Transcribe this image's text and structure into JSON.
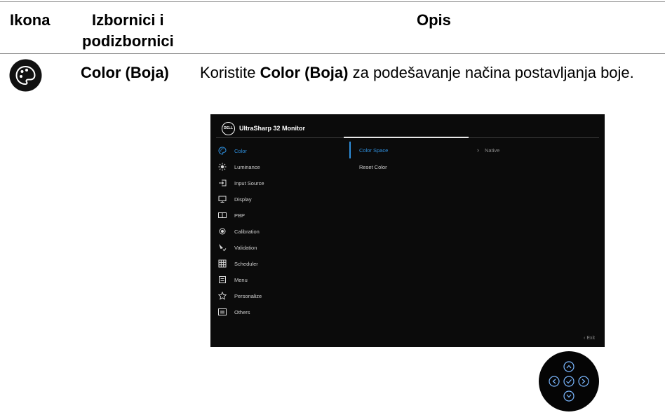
{
  "table": {
    "headers": {
      "icon": "Ikona",
      "menus_line1": "Izbornici i",
      "menus_line2": "podizbornici",
      "description": "Opis"
    },
    "row": {
      "icon_name": "palette-icon",
      "menu_title": "Color (Boja)",
      "desc_prefix": "Koristite ",
      "desc_bold": "Color (Boja)",
      "desc_suffix": " za podešavanje načina postavljanja boje."
    }
  },
  "osd": {
    "model": "UltraSharp 32 Monitor",
    "logo_text": "DELL",
    "menu_items": [
      {
        "label": "Color",
        "icon": "palette-icon"
      },
      {
        "label": "Luminance",
        "icon": "sun-icon"
      },
      {
        "label": "Input Source",
        "icon": "input-icon"
      },
      {
        "label": "Display",
        "icon": "monitor-icon"
      },
      {
        "label": "PBP",
        "icon": "split-screen-icon"
      },
      {
        "label": "Calibration",
        "icon": "target-icon"
      },
      {
        "label": "Validation",
        "icon": "validation-icon"
      },
      {
        "label": "Scheduler",
        "icon": "grid-icon"
      },
      {
        "label": "Menu",
        "icon": "menu-icon"
      },
      {
        "label": "Personalize",
        "icon": "star-icon"
      },
      {
        "label": "Others",
        "icon": "info-icon"
      }
    ],
    "active_item": "Color",
    "submenu": [
      {
        "label": "Color Space",
        "value": "Native"
      },
      {
        "label": "Reset Color"
      }
    ],
    "exit_label": "Exit",
    "accent_color": "#2f8fdd"
  }
}
